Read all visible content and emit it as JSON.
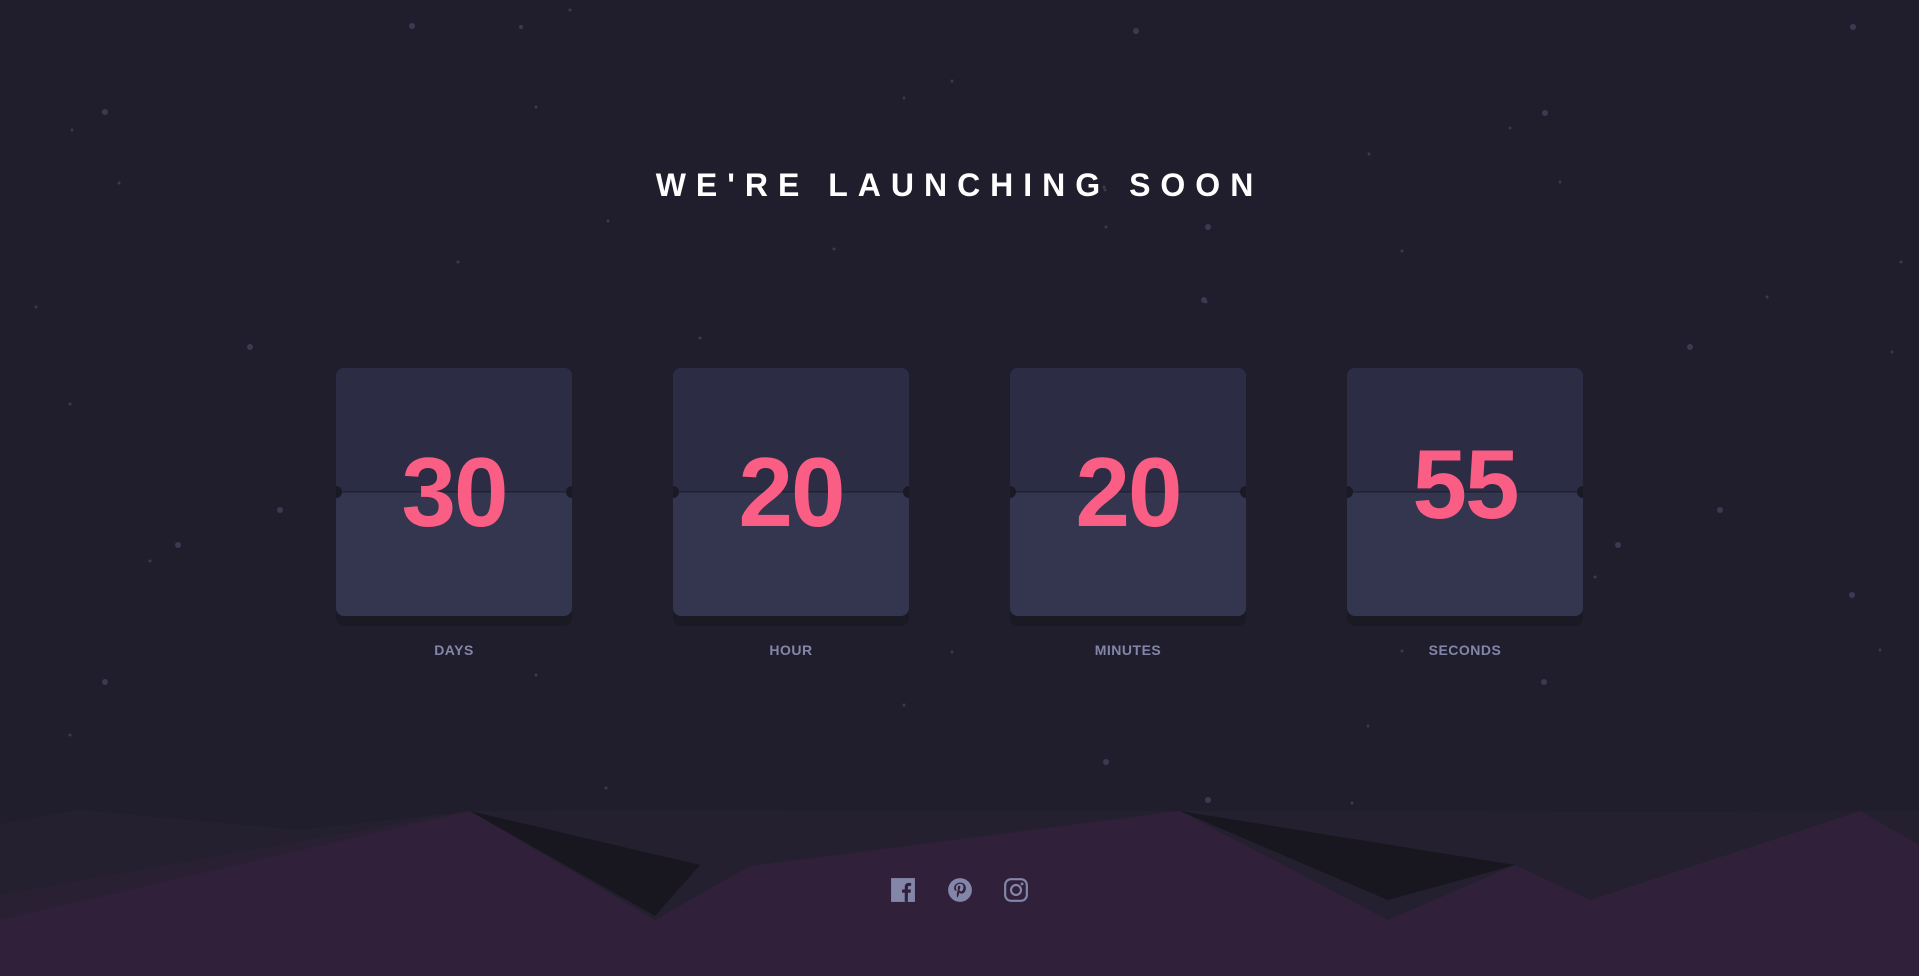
{
  "headline": "WE'RE LAUNCHING SOON",
  "countdown": [
    {
      "value": "30",
      "label": "DAYS"
    },
    {
      "value": "20",
      "label": "HOUR"
    },
    {
      "value": "20",
      "label": "MINUTES"
    },
    {
      "value": "55",
      "label": "SECONDS"
    }
  ],
  "social": [
    {
      "icon": "facebook-icon"
    },
    {
      "icon": "pinterest-icon"
    },
    {
      "icon": "instagram-icon"
    }
  ],
  "colors": {
    "background": "#201e2c",
    "card": "#343650",
    "digits": "#fb5e84",
    "label": "#8486a9",
    "hills": "#30203a",
    "icon": "#8486a9"
  }
}
